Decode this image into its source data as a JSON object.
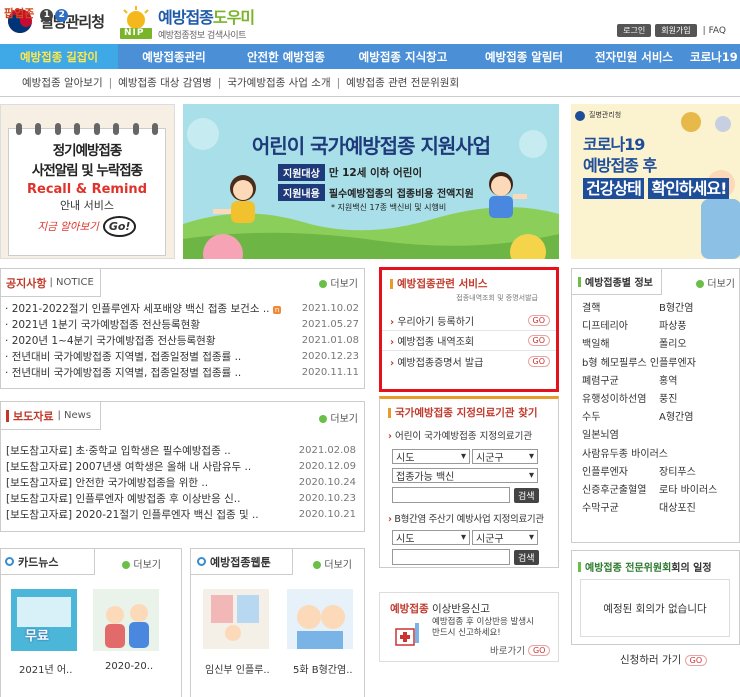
{
  "header": {
    "org_name": "질병관리청",
    "site_title_a": "예방접종",
    "site_title_b": "도우미",
    "site_sub": "예방접종정보 검색사이트",
    "logo_badge": "NIP",
    "login": "로그인",
    "join": "회원가입",
    "faq": "FAQ"
  },
  "gnb": [
    "예방접종 길잡이",
    "예방접종관리",
    "안전한 예방접종",
    "예방접종 지식창고",
    "예방접종 알림터",
    "전자민원 서비스",
    "코로나19"
  ],
  "subnav": [
    "예방접종 알아보기",
    "예방접종 대상 감염병",
    "국가예방접종 사업 소개",
    "예방접종 관련 전문위원회"
  ],
  "popup": {
    "label": "팝업존",
    "nums": [
      "1",
      "2"
    ],
    "title1": "정기예방접종",
    "title2": "사전알림 및 누락접종",
    "title3": "Recall & Remind",
    "title4": "안내 서비스",
    "title5": "지금 알아보기",
    "go": "Go!"
  },
  "main_banner": {
    "title": "어린이 국가예방접종 지원사업",
    "label1": "지원대상",
    "text1": "만 12세 이하 어린이",
    "label2": "지원내용",
    "text2": "필수예방접종의 접종비용 전액지원",
    "note": "* 지원백신 17종 백신비 및 시행비"
  },
  "right_banner": {
    "org": "질병관리청",
    "line1": "코로나19",
    "line2": "예방접종 후",
    "line3": "건강상태",
    "line4": "확인하세요!"
  },
  "notice": {
    "title": "공지사항",
    "title_en": "NOTICE",
    "more": "더보기",
    "items": [
      {
        "text": "2021-2022절기 인플루엔자 세포배양 백신 접종 보건소 ..",
        "date": "2021.10.02",
        "new": "n"
      },
      {
        "text": "2021년 1분기 국가예방접종 전산등록현황",
        "date": "2021.05.27",
        "new": ""
      },
      {
        "text": "2020년 1~4분기 국가예방접종 전산등록현황",
        "date": "2021.01.08",
        "new": ""
      },
      {
        "text": "전년대비 국가예방접종 지역별, 접종일정별 접종률 ..",
        "date": "2020.12.23",
        "new": ""
      },
      {
        "text": "전년대비 국가예방접종 지역별, 접종일정별 접종률 ..",
        "date": "2020.11.11",
        "new": ""
      }
    ]
  },
  "press": {
    "title": "보도자료",
    "title_en": "News",
    "more": "더보기",
    "items": [
      {
        "text": "[보도참고자료] 초·중학교 입학생은 필수예방접종 ..",
        "date": "2021.02.08"
      },
      {
        "text": "[보도참고자료] 2007년생 여학생은 올해 내 사람유두 ..",
        "date": "2020.12.09"
      },
      {
        "text": "[보도참고자료] 안전한 국가예방접종을 위한 ..",
        "date": "2020.10.24"
      },
      {
        "text": "[보도참고자료] 인플루엔자 예방접종 후 이상반응 신..",
        "date": "2020.10.23"
      },
      {
        "text": "[보도참고자료] 2020-21절기 인플루엔자 백신 접종 및 ..",
        "date": "2020.10.21"
      }
    ]
  },
  "cards": {
    "title": "카드뉴스",
    "more": "더보기",
    "thumb1": "무료",
    "items": [
      "2021년 어..",
      "2020-20.."
    ]
  },
  "webtoon": {
    "title": "예방접종웹툰",
    "more": "더보기",
    "items": [
      "임신부 인플루..",
      "5화 B형간염.."
    ]
  },
  "service": {
    "title": "예방접종관련 서비스",
    "sub": "접종내역조회 및 증명서발급",
    "go": "GO",
    "items": [
      "우리아기 등록하기",
      "예방접종 내역조회",
      "예방접종증명서 발급"
    ]
  },
  "hospital": {
    "title": "국가예방접종 지정의료기관 찾기",
    "sub1": "어린이 국가예방접종 지정의료기관",
    "sido": "시도",
    "sigungu": "시군구",
    "vaccine": "접종가능 백신",
    "search": "검색",
    "sub2": "B형간염 주산기 예방사업 지정의료기관"
  },
  "adverse": {
    "title_a": "예방접종",
    "title_b": " 이상반응신고",
    "text1": "예방접종 후 이상반응 발생시",
    "text2": "반드시 신고하세요!",
    "link": "바로가기",
    "go": "GO"
  },
  "disease": {
    "title": "예방접종별 정보",
    "more": "더보기",
    "items": [
      "결핵",
      "B형간염",
      "디프테리아",
      "파상풍",
      "백일해",
      "폴리오",
      "b형 헤모필루스 인플루엔자",
      "",
      "폐렴구균",
      "홍역",
      "유행성이하선염",
      "풍진",
      "수두",
      "A형간염",
      "일본뇌염",
      "",
      "사람유두종 바이러스",
      "",
      "인플루엔자",
      "장티푸스",
      "신증후군출혈열",
      "로타 바이러스",
      "수막구균",
      "대상포진"
    ]
  },
  "meeting": {
    "title_a": "예방접종 전문위원회",
    "title_b": " 회의 일정",
    "text": "예정된 회의가 없습니다"
  },
  "apply": {
    "text": "신청하러 가기",
    "go": "GO"
  },
  "colors": {
    "gnb": "#4b8fd6",
    "active": "#3fa8e6",
    "highlight": "#e4121a",
    "accent": "#6ac046"
  }
}
